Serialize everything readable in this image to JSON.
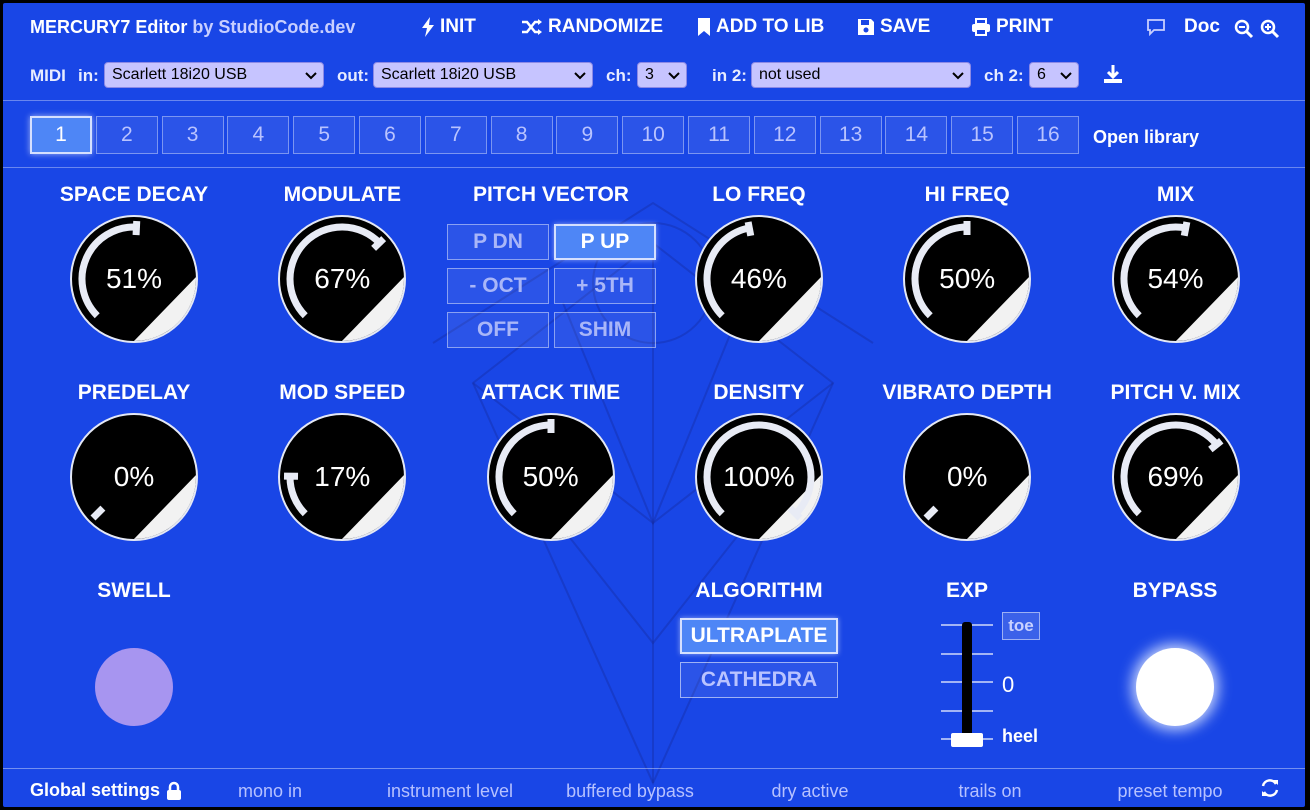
{
  "app": {
    "title": "MERCURY7 Editor",
    "by": "by StudioCode.dev",
    "accent_color": "#1946e6",
    "active_color": "#4e86f6"
  },
  "toolbar": {
    "init": "INIT",
    "randomize": "RANDOMIZE",
    "add_to_lib": "ADD TO LIB",
    "save": "SAVE",
    "print": "PRINT",
    "doc": "Doc"
  },
  "midi": {
    "label": "MIDI",
    "in_label": "in:",
    "in_value": "Scarlett 18i20 USB",
    "out_label": "out:",
    "out_value": "Scarlett 18i20 USB",
    "ch_label": "ch:",
    "ch_value": "3",
    "in2_label": "in 2:",
    "in2_value": "not used",
    "ch2_label": "ch 2:",
    "ch2_value": "6"
  },
  "presets": {
    "items": [
      "1",
      "2",
      "3",
      "4",
      "5",
      "6",
      "7",
      "8",
      "9",
      "10",
      "11",
      "12",
      "13",
      "14",
      "15",
      "16"
    ],
    "active": "1",
    "open_library": "Open library"
  },
  "knobs": {
    "space_decay": {
      "label": "SPACE DECAY",
      "value": "51%",
      "level": 0.51
    },
    "modulate": {
      "label": "MODULATE",
      "value": "67%",
      "level": 0.67
    },
    "lo_freq": {
      "label": "LO FREQ",
      "value": "46%",
      "level": 0.46
    },
    "hi_freq": {
      "label": "HI FREQ",
      "value": "50%",
      "level": 0.5
    },
    "mix": {
      "label": "MIX",
      "value": "54%",
      "level": 0.54
    },
    "predelay": {
      "label": "PREDELAY",
      "value": "0%",
      "level": 0.0
    },
    "mod_speed": {
      "label": "MOD SPEED",
      "value": "17%",
      "level": 0.17
    },
    "attack_time": {
      "label": "ATTACK TIME",
      "value": "50%",
      "level": 0.5
    },
    "density": {
      "label": "DENSITY",
      "value": "100%",
      "level": 1.0
    },
    "vibrato_depth": {
      "label": "VIBRATO DEPTH",
      "value": "0%",
      "level": 0.0
    },
    "pitch_v_mix": {
      "label": "PITCH V. MIX",
      "value": "69%",
      "level": 0.69
    }
  },
  "pitch_vector": {
    "label": "PITCH VECTOR",
    "options": [
      "P DN",
      "P UP",
      "- OCT",
      "+ 5TH",
      "OFF",
      "SHIM"
    ],
    "active": "P UP"
  },
  "swell": {
    "label": "SWELL",
    "color": "#a795f0"
  },
  "algorithm": {
    "label": "ALGORITHM",
    "options": [
      "ULTRAPLATE",
      "CATHEDRA"
    ],
    "active": "ULTRAPLATE"
  },
  "exp": {
    "label": "EXP",
    "toe": "toe",
    "value": "0",
    "heel": "heel",
    "level": 0.0
  },
  "bypass": {
    "label": "BYPASS",
    "color": "#ffffff"
  },
  "global": {
    "label": "Global settings",
    "items": [
      "mono in",
      "instrument level",
      "buffered bypass",
      "dry active",
      "trails on",
      "preset tempo"
    ]
  }
}
